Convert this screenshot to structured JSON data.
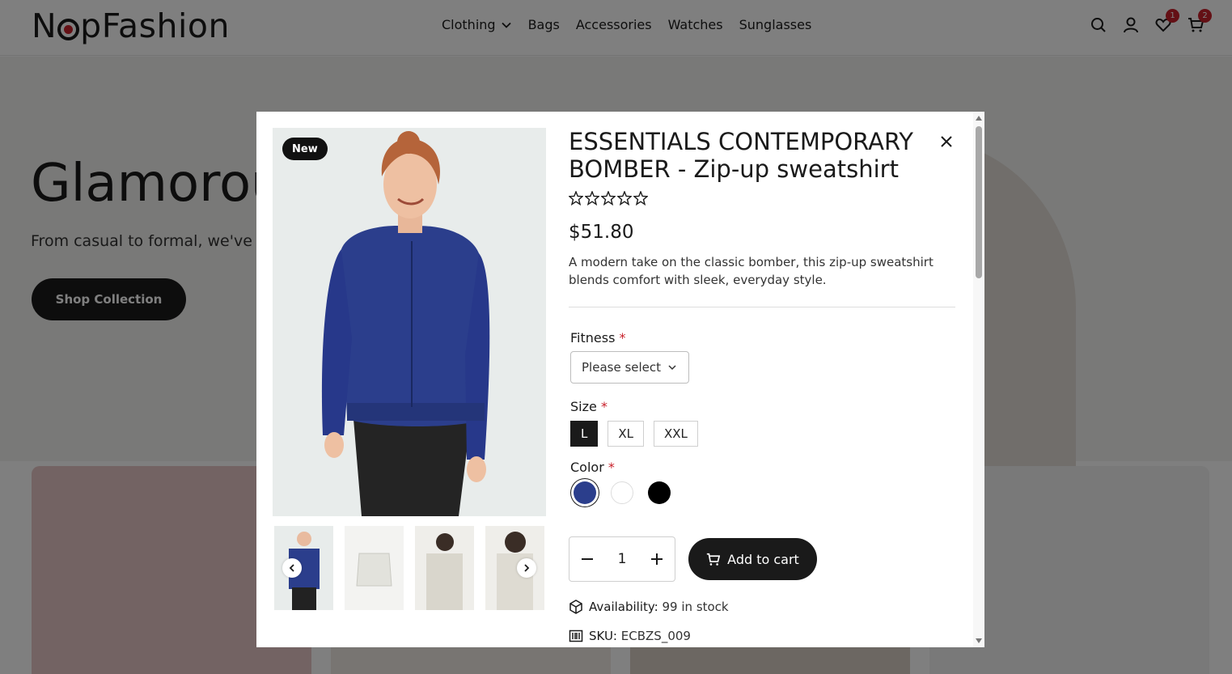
{
  "header": {
    "logo_part1": "N",
    "logo_part2": "pFashion",
    "nav": [
      "Clothing",
      "Bags",
      "Accessories",
      "Watches",
      "Sunglasses"
    ],
    "wishlist_count": "1",
    "cart_count": "2"
  },
  "hero": {
    "title": "Glamorou",
    "subtitle": "From casual to formal, we've g",
    "button": "Shop Collection"
  },
  "product": {
    "badge": "New",
    "title": "ESSENTIALS CONTEMPORARY BOMBER - Zip-up sweatshirt",
    "rating": 0,
    "rating_max": 5,
    "price": "$51.80",
    "description": "A modern take on the classic bomber, this zip-up sweatshirt blends comfort with sleek, everyday style.",
    "fitness_label": "Fitness",
    "fitness_placeholder": "Please select",
    "size_label": "Size",
    "sizes": [
      "L",
      "XL",
      "XXL"
    ],
    "size_selected": "L",
    "color_label": "Color",
    "colors": [
      "#2b3e8c",
      "#ffffff",
      "#000000"
    ],
    "color_selected": "#2b3e8c",
    "quantity": "1",
    "add_to_cart": "Add to cart",
    "availability_label": "Availability:",
    "availability_value": "99 in stock",
    "sku_label": "SKU:",
    "sku_value": "ECBZS_009",
    "required_mark": "*"
  }
}
